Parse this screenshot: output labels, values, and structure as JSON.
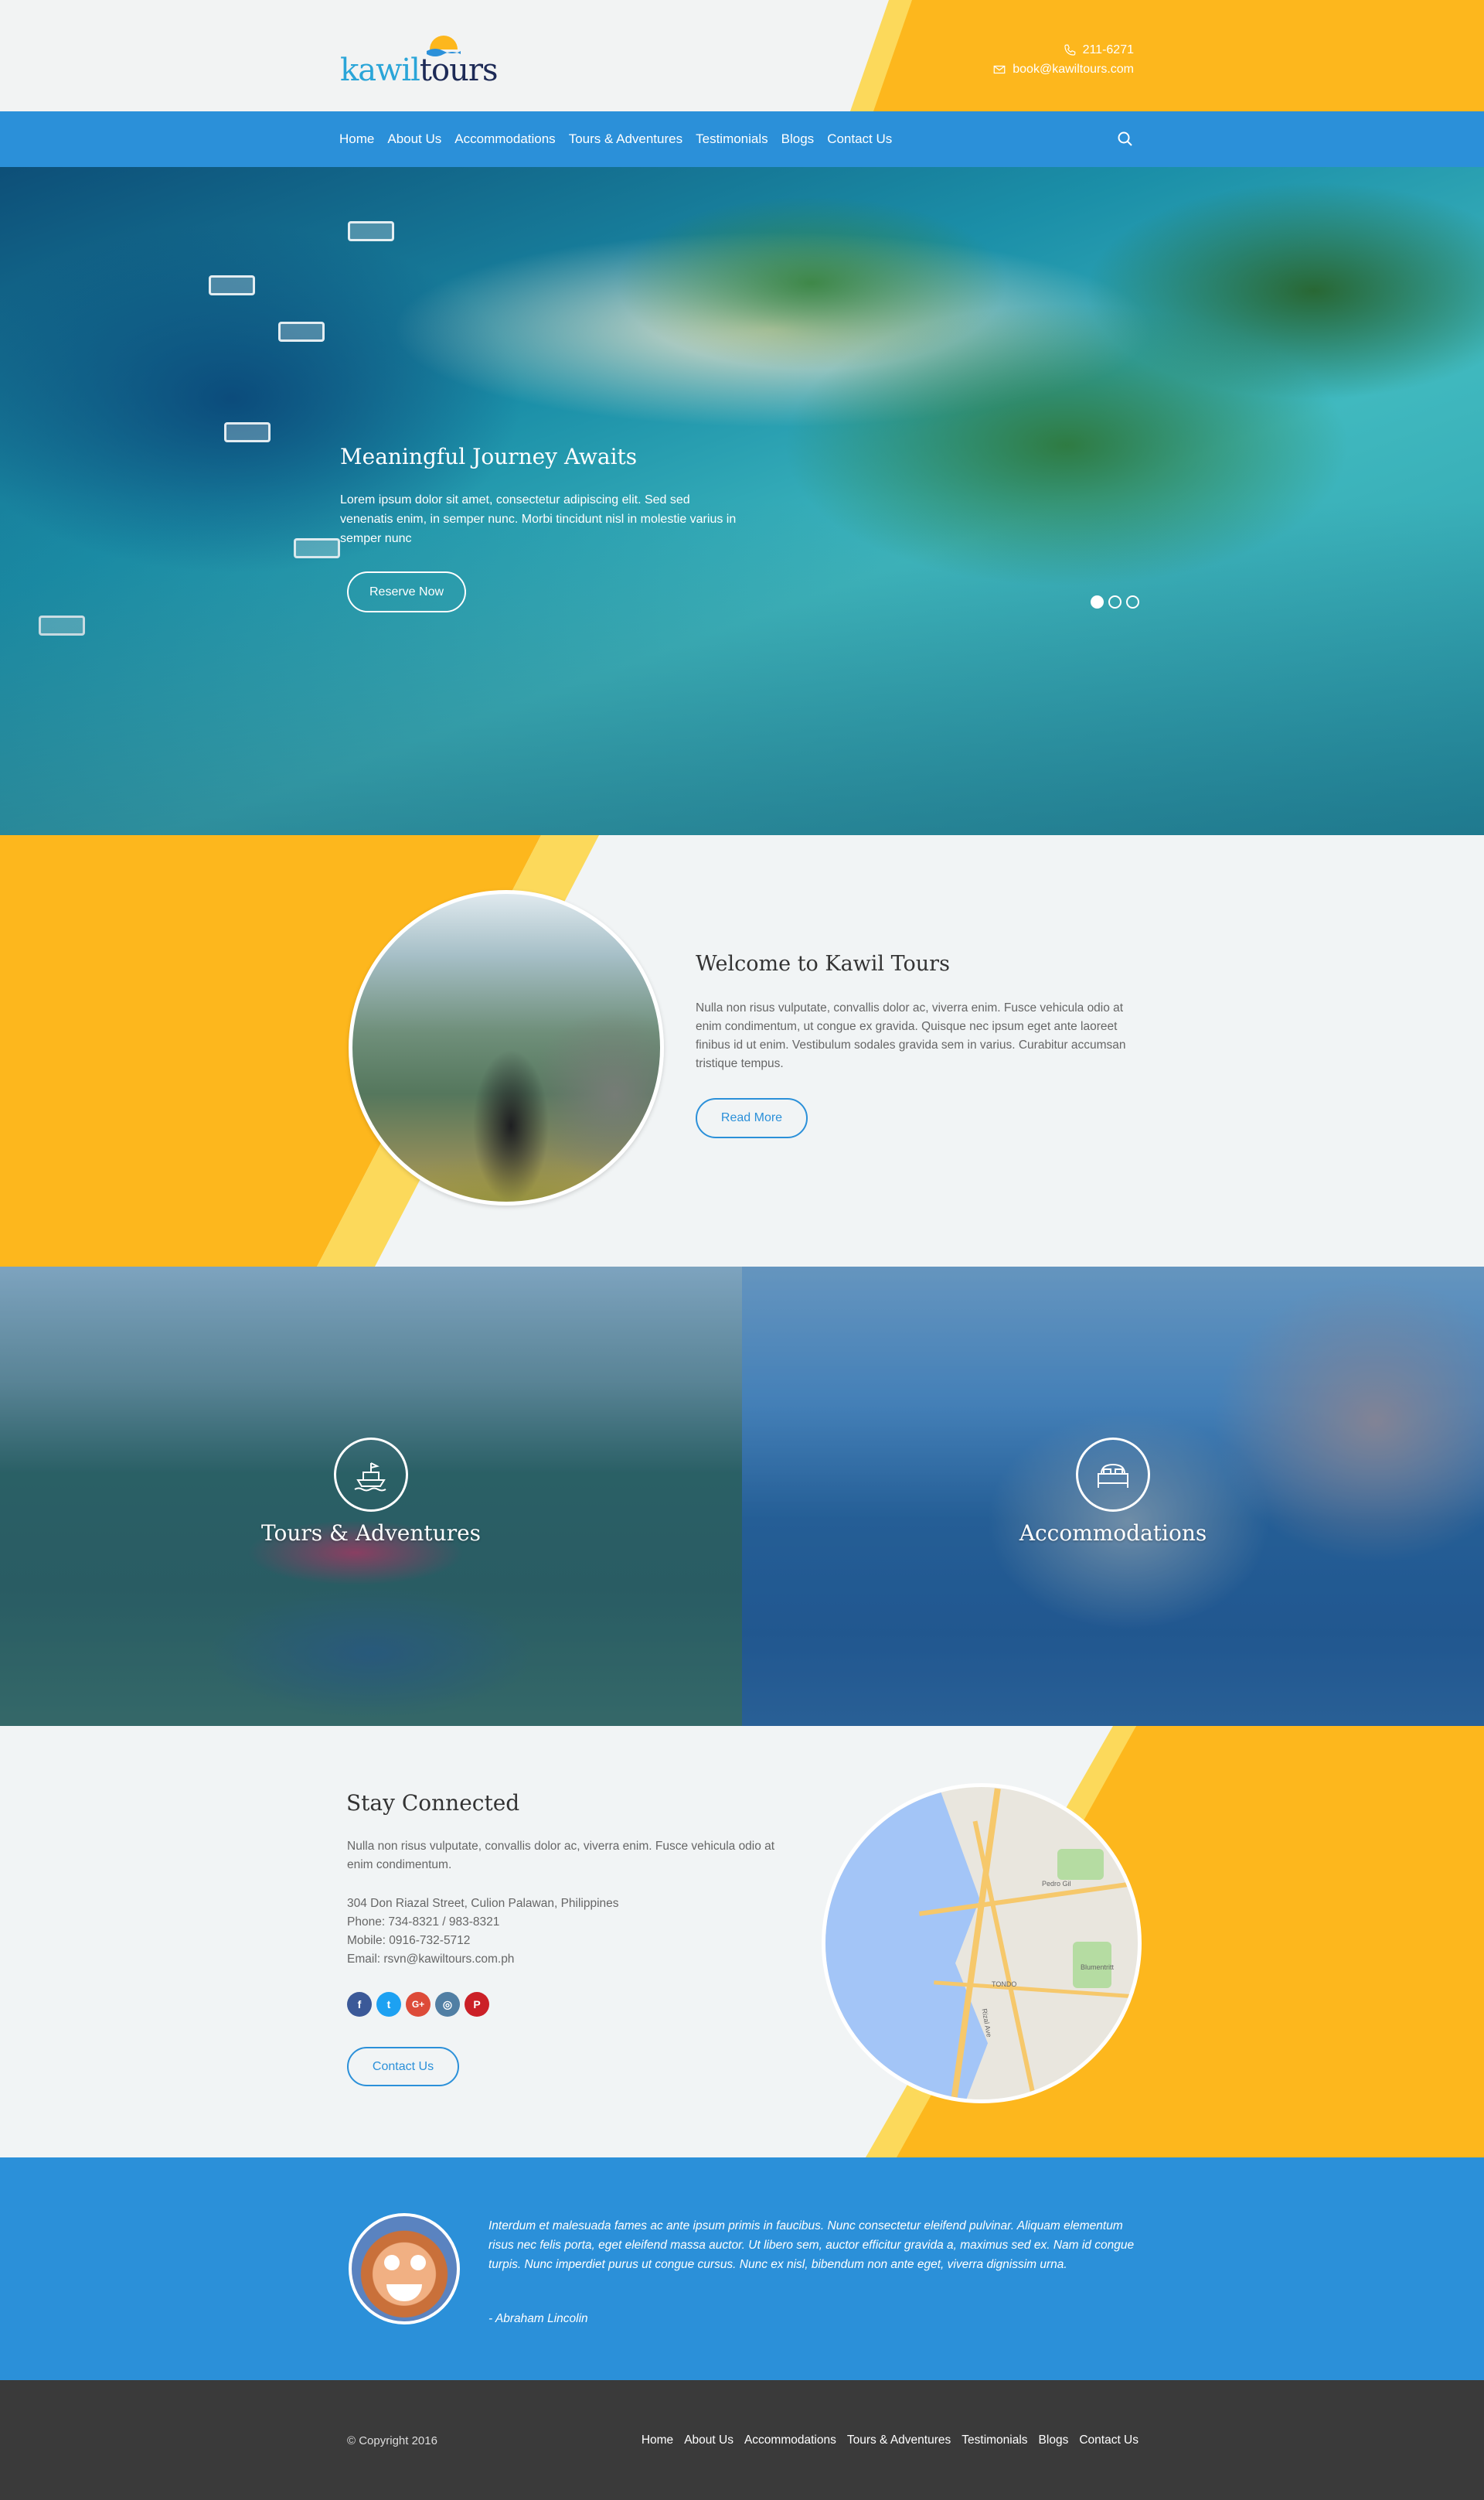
{
  "brand": {
    "logo_part1": "kawil",
    "logo_part2": "tours",
    "color_blue": "#2b90d9",
    "color_yellow": "#fdb71d"
  },
  "contact_top": {
    "phone": "211-6271",
    "email": "book@kawiltours.com"
  },
  "nav": {
    "items": [
      "Home",
      "About Us",
      "Accommodations",
      "Tours & Adventures",
      "Testimonials",
      "Blogs",
      "Contact Us"
    ],
    "search_icon": "search-icon"
  },
  "hero": {
    "title": "Meaningful Journey Awaits",
    "text": "Lorem ipsum dolor sit amet, consectetur adipiscing elit. Sed sed venenatis enim, in semper nunc. Morbi tincidunt nisl in molestie varius in semper nunc",
    "button": "Reserve Now",
    "slides": 3,
    "active_slide": 1
  },
  "welcome": {
    "title": "Welcome to Kawil Tours",
    "text": "Nulla non risus vulputate, convallis dolor ac, viverra enim. Fusce vehicula odio at enim condimentum, ut congue ex gravida. Quisque nec ipsum eget ante laoreet finibus id ut enim. Vestibulum sodales gravida sem in varius. Curabitur accumsan tristique tempus.",
    "button": "Read More"
  },
  "tiles": [
    {
      "title": "Tours & Adventures",
      "icon": "boat-icon"
    },
    {
      "title": "Accommodations",
      "icon": "bed-icon"
    }
  ],
  "connect": {
    "title": "Stay Connected",
    "text": "Nulla non risus vulputate, convallis dolor ac, viverra enim. Fusce vehicula odio at enim condimentum.",
    "address": "304 Don Riazal Street, Culion Palawan, Philippines",
    "phone": "Phone: 734-8321 / 983-8321",
    "mobile": "Mobile: 0916-732-5712",
    "email": "Email: rsvn@kawiltours.com.ph",
    "socials": [
      {
        "icon": "facebook-icon",
        "glyph": "f",
        "color": "#3b5998"
      },
      {
        "icon": "twitter-icon",
        "glyph": "t",
        "color": "#1da1f2"
      },
      {
        "icon": "google-plus-icon",
        "glyph": "G+",
        "color": "#dd4b39"
      },
      {
        "icon": "instagram-icon",
        "glyph": "◎",
        "color": "#517fa4"
      },
      {
        "icon": "pinterest-icon",
        "glyph": "P",
        "color": "#cb2027"
      }
    ],
    "button": "Contact Us",
    "map_labels": {
      "district": "TONDO",
      "area": "Blumentritt",
      "road": "Pedro Gil",
      "road2": "Rizal Ave"
    }
  },
  "testimonial": {
    "quote": "Interdum et malesuada fames ac ante ipsum primis in faucibus. Nunc consectetur eleifend pulvinar. Aliquam elementum risus nec felis porta, eget eleifend massa auctor. Ut libero sem, auctor efficitur gravida a, maximus sed ex. Nam id congue turpis. Nunc imperdiet purus ut congue cursus. Nunc ex nisl, bibendum non ante eget, viverra dignissim urna.",
    "author": "- Abraham Lincolin"
  },
  "footer": {
    "copyright": "© Copyright 2016",
    "links": [
      "Home",
      "About Us",
      "Accommodations",
      "Tours & Adventures",
      "Testimonials",
      "Blogs",
      "Contact Us"
    ]
  }
}
